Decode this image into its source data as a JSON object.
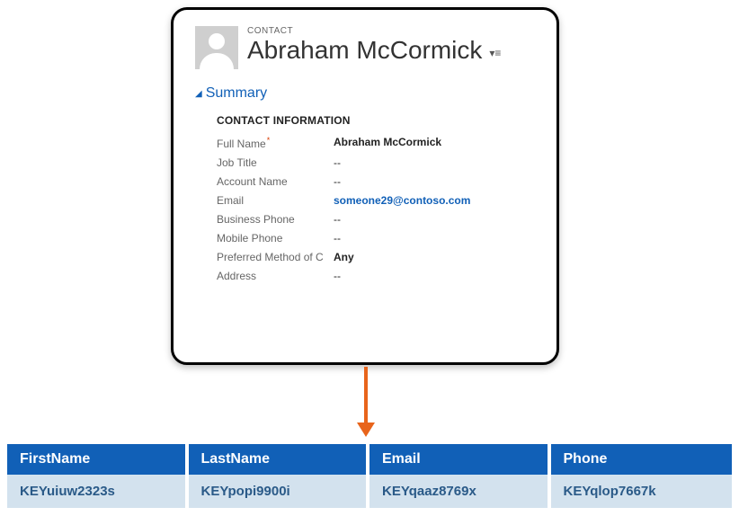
{
  "contact": {
    "record_type": "CONTACT",
    "name": "Abraham McCormick",
    "summary_label": "Summary",
    "section_title": "CONTACT INFORMATION",
    "fields": {
      "full_name": {
        "label": "Full Name",
        "value": "Abraham McCormick",
        "required": true
      },
      "job_title": {
        "label": "Job Title",
        "value": "--"
      },
      "account_name": {
        "label": "Account Name",
        "value": "--"
      },
      "email": {
        "label": "Email",
        "value": "someone29@contoso.com"
      },
      "business_phone": {
        "label": "Business Phone",
        "value": "--"
      },
      "mobile_phone": {
        "label": "Mobile Phone",
        "value": "--"
      },
      "preferred_method": {
        "label": "Preferred Method of C",
        "value": "Any"
      },
      "address": {
        "label": "Address",
        "value": "--"
      }
    }
  },
  "table": {
    "headers": [
      "FirstName",
      "LastName",
      "Email",
      "Phone"
    ],
    "row": [
      "KEYuiuw2323s",
      "KEYpopi9900i",
      "KEYqaaz8769x",
      "KEYqlop7667k"
    ]
  },
  "colors": {
    "header_blue": "#1160b7",
    "row_blue": "#d3e2ee",
    "arrow_orange": "#e8641b"
  }
}
